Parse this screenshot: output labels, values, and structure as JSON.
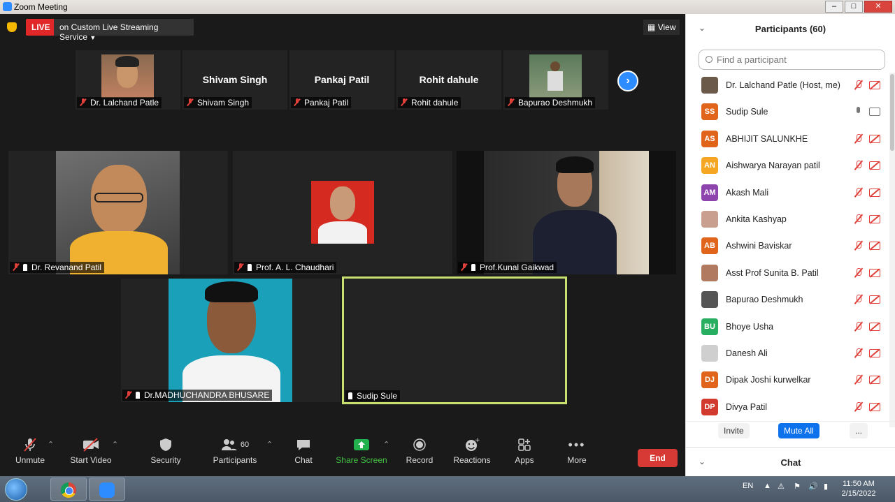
{
  "window": {
    "title": "Zoom Meeting"
  },
  "live": {
    "badge": "LIVE",
    "service": "on Custom Live Streaming Service",
    "view_label": "View"
  },
  "strip": [
    {
      "name": "Dr. Lalchand Patle",
      "center": ""
    },
    {
      "name": "Shivam Singh",
      "center": "Shivam Singh"
    },
    {
      "name": "Pankaj Patil",
      "center": "Pankaj Patil"
    },
    {
      "name": "Rohit dahule",
      "center": "Rohit dahule"
    },
    {
      "name": "Bapurao Deshmukh",
      "center": ""
    }
  ],
  "gallery": [
    {
      "name": "Dr. Revanand Patil"
    },
    {
      "name": "Prof. A. L. Chaudhari"
    },
    {
      "name": "Prof.Kunal Gaikwad"
    },
    {
      "name": "Dr.MADHUCHANDRA BHUSARE"
    },
    {
      "name": "Sudip Sule"
    }
  ],
  "toolbar": {
    "unmute": "Unmute",
    "start_video": "Start Video",
    "security": "Security",
    "participants": "Participants",
    "participants_count": "60",
    "chat": "Chat",
    "share_screen": "Share Screen",
    "record": "Record",
    "reactions": "Reactions",
    "apps": "Apps",
    "more": "More",
    "end": "End"
  },
  "panel": {
    "title": "Participants (60)",
    "search_placeholder": "Find a participant",
    "participants": [
      {
        "name": "Dr. Lalchand Patle (Host, me)",
        "initials": "",
        "color": "#6b5a4a",
        "muted": true
      },
      {
        "name": "Sudip Sule",
        "initials": "SS",
        "color": "#e0651a",
        "muted": false
      },
      {
        "name": "ABHIJIT  SALUNKHE",
        "initials": "AS",
        "color": "#e0651a",
        "muted": true
      },
      {
        "name": "Aishwarya Narayan patil",
        "initials": "AN",
        "color": "#f5a623",
        "muted": true
      },
      {
        "name": "Akash Mali",
        "initials": "AM",
        "color": "#8e44ad",
        "muted": true
      },
      {
        "name": "Ankita Kashyap",
        "initials": "",
        "color": "#c9a090",
        "muted": true
      },
      {
        "name": "Ashwini  Baviskar",
        "initials": "AB",
        "color": "#e0651a",
        "muted": true
      },
      {
        "name": "Asst Prof Sunita B. Patil",
        "initials": "",
        "color": "#b07a60",
        "muted": true
      },
      {
        "name": "Bapurao Deshmukh",
        "initials": "",
        "color": "#555555",
        "muted": true
      },
      {
        "name": "Bhoye Usha",
        "initials": "BU",
        "color": "#27ae60",
        "muted": true
      },
      {
        "name": "Danesh Ali",
        "initials": "",
        "color": "#cfcfcf",
        "muted": true
      },
      {
        "name": "Dipak Joshi kurwelkar",
        "initials": "DJ",
        "color": "#e0651a",
        "muted": true
      },
      {
        "name": "Divya Patil",
        "initials": "DP",
        "color": "#d33a2f",
        "muted": true
      }
    ],
    "invite": "Invite",
    "mute_all": "Mute All",
    "more": "...",
    "chat_title": "Chat"
  },
  "taskbar": {
    "lang": "EN",
    "time": "11:50 AM",
    "date": "2/15/2022"
  }
}
